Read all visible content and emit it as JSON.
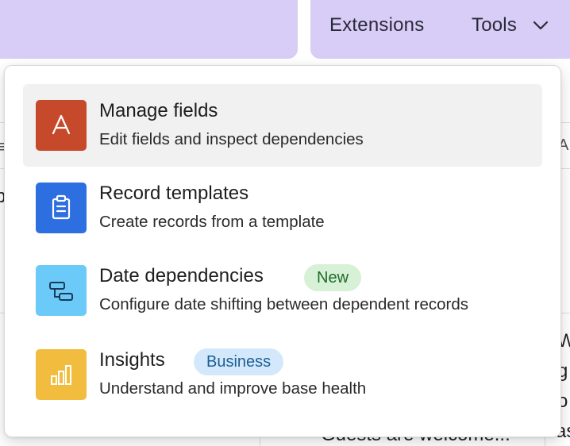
{
  "topbar": {
    "tabs": [
      {
        "label": "Extensions"
      },
      {
        "label": "Tools"
      }
    ],
    "tools_chevron_icon": "chevron-down-icon"
  },
  "background": {
    "fragments": [
      "≡",
      "b",
      "A",
      "W",
      "g",
      "o",
      "as",
      "Guests are welcome..."
    ]
  },
  "menu": {
    "items": [
      {
        "title": "Manage fields",
        "description": "Edit fields and inspect dependencies",
        "icon": "field-a-icon",
        "icon_color": "#c5492a",
        "active": true
      },
      {
        "title": "Record templates",
        "description": "Create records from a template",
        "icon": "clipboard-icon",
        "icon_color": "#2d6ee0"
      },
      {
        "title": "Date dependencies",
        "description": "Configure date shifting between dependent records",
        "icon": "dependency-icon",
        "icon_color": "#6ccaf8",
        "badge": "New",
        "badge_color": "#d6f1d6"
      },
      {
        "title": "Insights",
        "description": "Understand and improve base health",
        "icon": "bar-chart-icon",
        "icon_color": "#f2bd3f",
        "badge": "Business",
        "badge_color": "#d3e9fb"
      }
    ]
  }
}
